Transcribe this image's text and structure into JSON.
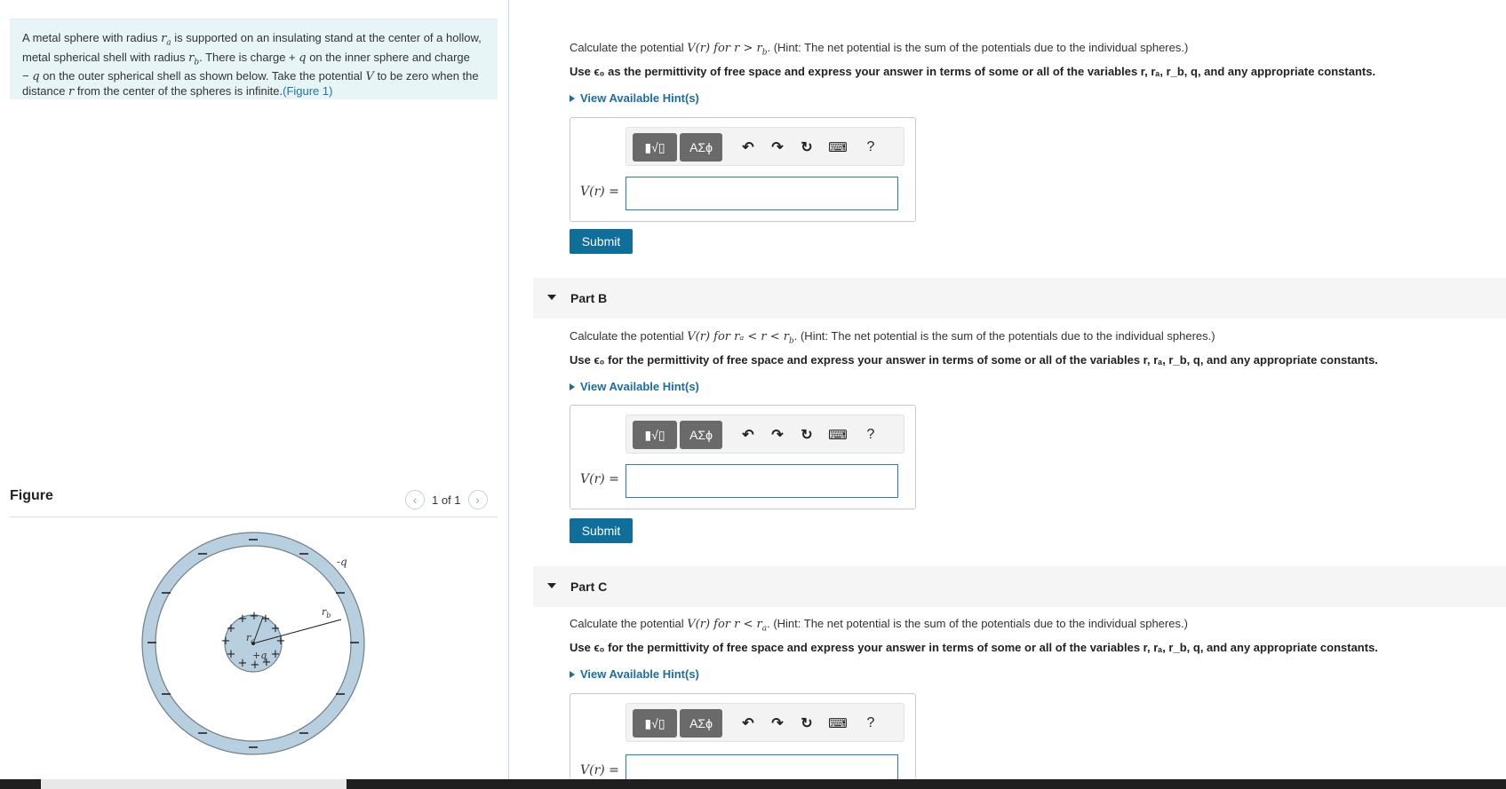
{
  "problem": {
    "line1_a": "A metal sphere with radius ",
    "line1_var": "r",
    "line1_sub": "a",
    "line1_b": " is supported on an insulating stand at the center of a hollow,",
    "line2_a": "metal spherical shell with radius ",
    "line2_var": "r",
    "line2_sub": "b",
    "line2_b": ". There is charge + ",
    "line2_q": "q",
    "line2_c": " on the inner sphere and charge",
    "line3_a": "− ",
    "line3_q": "q",
    "line3_b": " on the outer spherical shell as shown below. Take the potential ",
    "line3_v": "V",
    "line3_c": " to be zero when the",
    "line4_a": "distance ",
    "line4_r": "r",
    "line4_b": " from the center of the spheres is infinite.",
    "figure_link": "(Figure 1)"
  },
  "figure_panel": {
    "title": "Figure",
    "pager": "1 of 1",
    "labels": {
      "outer_charge": "-q",
      "rb": "r",
      "rb_sub": "b",
      "ra": "r",
      "ra_sub": "a",
      "inner_charge": "+q"
    }
  },
  "parts": [
    {
      "question_pre": "Calculate the potential ",
      "question_fn": "V(r)",
      "question_cond": " for r > r",
      "question_cond_sub": "b",
      "question_post": ". (Hint: The net potential is the sum of the potentials due to the individual spheres.)",
      "instruction": "Use ϵ₀ as the permittivity of free space and express your answer in terms of some or all of the variables r, rₐ, r_b, q, and any appropriate constants.",
      "hint_link": "View Available Hint(s)",
      "eq_label": "V(r) =",
      "submit": "Submit"
    },
    {
      "title": "Part B",
      "question_pre": "Calculate the potential ",
      "question_fn": "V(r)",
      "question_cond": " for rₐ < r < r",
      "question_cond_sub": "b",
      "question_post": ". (Hint: The net potential is the sum of the potentials due to the individual spheres.)",
      "instruction": "Use ϵ₀ for the permittivity of free space and express your answer in terms of some or all of the variables r, rₐ, r_b, q, and any appropriate constants.",
      "hint_link": "View Available Hint(s)",
      "eq_label": "V(r) =",
      "submit": "Submit"
    },
    {
      "title": "Part C",
      "question_pre": "Calculate the potential ",
      "question_fn": "V(r)",
      "question_cond": " for r < r",
      "question_cond_sub": "a",
      "question_post": ". (Hint: The net potential is the sum of the potentials due to the individual spheres.)",
      "instruction": "Use ϵ₀ for the permittivity of free space and express your answer in terms of some or all of the variables r, rₐ, r_b, q, and any appropriate constants.",
      "hint_link": "View Available Hint(s)",
      "eq_label": "V(r) ="
    }
  ],
  "toolbar": {
    "template_label": "▮√▯",
    "greek_label": "ΑΣϕ",
    "undo_icon": "↶",
    "redo_icon": "↷",
    "reset_icon": "↻",
    "keyboard_icon": "⌨",
    "help_label": "?"
  },
  "colors": {
    "accent": "#0f6e9a",
    "link": "#1a73a8",
    "intro_bg": "#e8f5f7",
    "sphere_fill": "#b7cfdf"
  }
}
